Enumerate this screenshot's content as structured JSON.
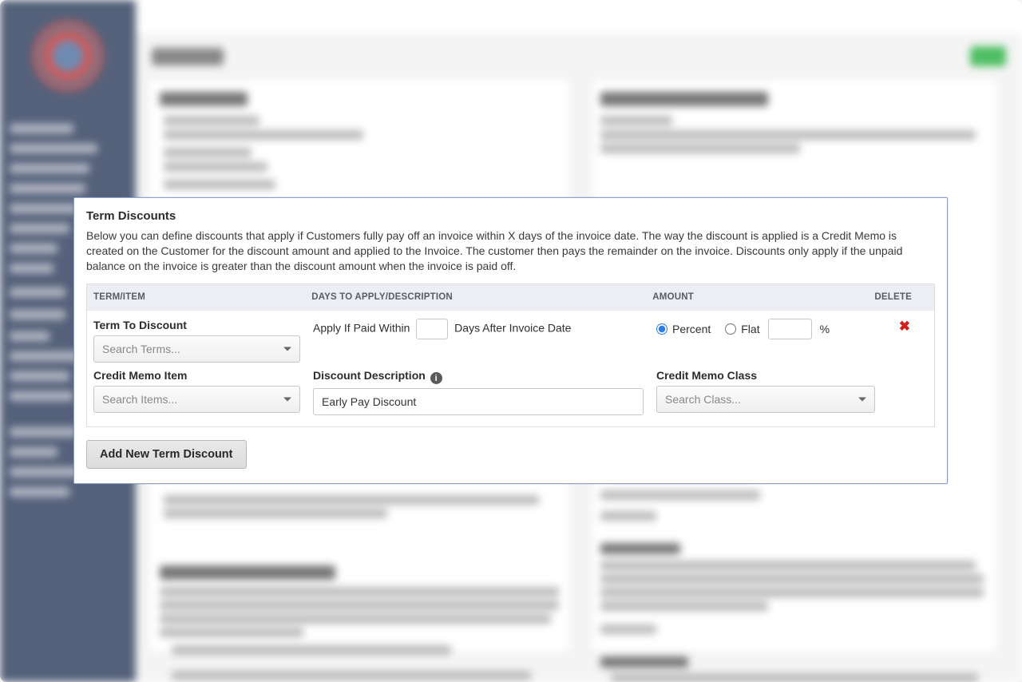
{
  "modal": {
    "title": "Term Discounts",
    "description": "Below you can define discounts that apply if Customers fully pay off an invoice within X days of the invoice date. The way the discount is applied is a Credit Memo is created on the Customer for the discount amount and applied to the Invoice. The customer then pays the remainder on the invoice. Discounts only apply if the unpaid balance on the invoice is greater than the discount amount when the invoice is paid off.",
    "columns": {
      "term": "TERM/ITEM",
      "days": "DAYS TO APPLY/DESCRIPTION",
      "amount": "AMOUNT",
      "delete": "DELETE"
    },
    "row": {
      "term_label": "Term To Discount",
      "term_placeholder": "Search Terms...",
      "apply_prefix": "Apply If Paid Within",
      "apply_suffix": "Days After Invoice Date",
      "percent_label": "Percent",
      "flat_label": "Flat",
      "percent_symbol": "%",
      "memo_item_label": "Credit Memo Item",
      "memo_item_placeholder": "Search Items...",
      "desc_label": "Discount Description",
      "desc_value": "Early Pay Discount",
      "memo_class_label": "Credit Memo Class",
      "memo_class_placeholder": "Search Class...",
      "delete_icon": "✖"
    },
    "add_button": "Add New Term Discount"
  }
}
